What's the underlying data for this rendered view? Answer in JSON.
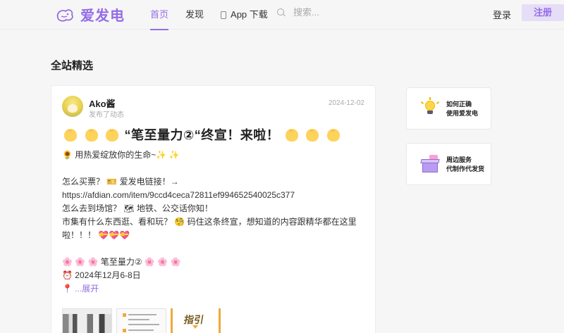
{
  "header": {
    "logo_text": "爱发电",
    "nav": [
      {
        "label": "首页",
        "active": true
      },
      {
        "label": "发现",
        "active": false
      },
      {
        "label": "App 下载",
        "active": false,
        "icon": "phone-icon"
      }
    ],
    "search_placeholder": "搜索...",
    "login_label": "登录",
    "register_label": "注册",
    "accent_color": "#946ce6"
  },
  "section_title": "全站精选",
  "post": {
    "author": "Ako酱",
    "subline": "发布了动态",
    "date": "2024-12-02",
    "headline": "“笔至量力②“终宣！来啦！",
    "lines": [
      "🌻 用热爱绽放你的生命~✨ ✨",
      "",
      "怎么买票？ 🎫 爱发电链接！→",
      "https://afdian.com/item/9ccd4ceca72811ef994652540025c377",
      "怎么去到场馆？ 🗺 地铁、公交话你知！",
      "市集有什么东西逛、看和玩？ 🧐 码住这条终宣，想知道的内容跟精华都在这里",
      "啦！！！ 💝💝💝",
      "",
      "🌸 🌸 🌸  笔至量力②  🌸 🌸 🌸",
      "⏰   2024年12月6-8日"
    ],
    "expand_prefix": "📍 ",
    "expand_label": "...展开",
    "thumb3_text": "指引"
  },
  "side_cards": [
    {
      "line1": "如何正确",
      "line2": "使用爱发电",
      "icon": "lightbulb-icon"
    },
    {
      "line1": "周边服务",
      "line2": "代制作代发货",
      "icon": "package-icon"
    }
  ]
}
